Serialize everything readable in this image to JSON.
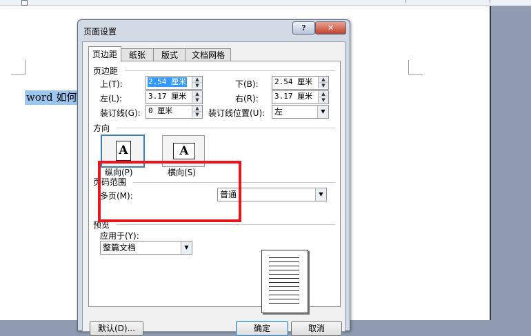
{
  "document": {
    "selected_text": "word 如何"
  },
  "dialog": {
    "title": "页面设置",
    "help_label": "?",
    "close_label": "✕",
    "tabs": [
      {
        "label": "页边距",
        "active": true
      },
      {
        "label": "纸张",
        "active": false
      },
      {
        "label": "版式",
        "active": false
      },
      {
        "label": "文档网格",
        "active": false
      }
    ],
    "margins": {
      "section_label": "页边距",
      "top_label": "上(T):",
      "top_value": "2.54 厘米",
      "bottom_label": "下(B):",
      "bottom_value": "2.54 厘米",
      "left_label": "左(L):",
      "left_value": "3.17 厘米",
      "right_label": "右(R):",
      "right_value": "3.17 厘米",
      "gutter_label": "装订线(G):",
      "gutter_value": "0 厘米",
      "gutter_pos_label": "装订线位置(U):",
      "gutter_pos_value": "左"
    },
    "orientation": {
      "section_label": "方向",
      "portrait_label": "纵向(P)",
      "landscape_label": "横向(S)",
      "icon_letter": "A",
      "selected": "portrait"
    },
    "pages": {
      "section_label": "页码范围",
      "multiple_label": "多页(M):",
      "multiple_value": "普通"
    },
    "preview": {
      "section_label": "预览",
      "apply_label": "应用于(Y):",
      "apply_value": "整篇文档"
    },
    "buttons": {
      "default_label": "默认(D)...",
      "ok_label": "确定",
      "cancel_label": "取消"
    }
  },
  "colors": {
    "highlight": "#e8161c",
    "selection": "#3399ff"
  }
}
